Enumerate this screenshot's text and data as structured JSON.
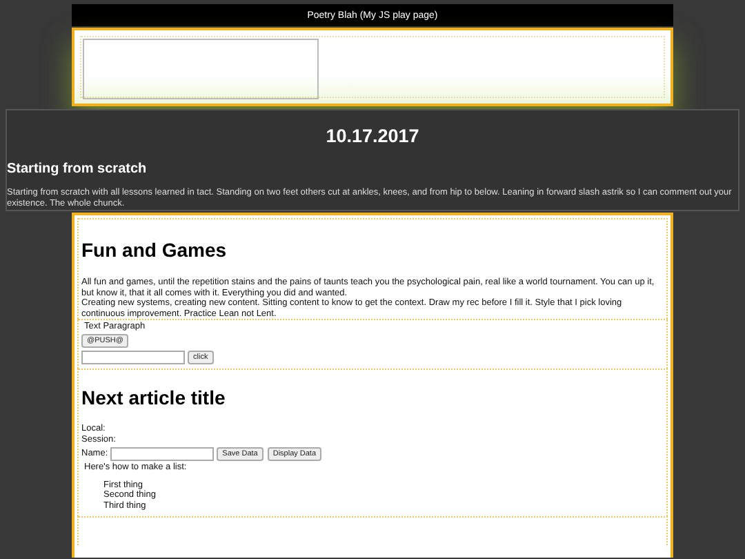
{
  "header": {
    "title": "Poetry Blah (My JS play page)"
  },
  "banner": {
    "date": "10.17.2017",
    "heading": "Starting from scratch",
    "text": "Starting from scratch with all lessons learned in tact. Standing on two feet others cut at ankles, knees, and from hip to below. Leaning in forward slash astrik so I can comment out your existence. The whole chunck."
  },
  "article": {
    "title": "Fun and Games",
    "paragraph": "All fun and games, until the repetition stains and the pains of taunts teach you the psychological pain, real like a world tournament. You can up it, but know it, that it all comes with it. Everything you did and wanted.",
    "paragraph_2": "Creating new systems, creating new content. Sitting content to know to get the context. Draw my rec before I fill it. Style that I pick loving continuous improvement. Practice Lean not Lent."
  },
  "widget": {
    "label": "Text Paragraph",
    "push_button": "@PUSH@",
    "click_button": "click"
  },
  "article_2": {
    "title": "Next article title",
    "local_label": "Local:",
    "session_label": "Session:",
    "name_label": "Name:",
    "save_button": "Save Data",
    "display_button": "Display Data",
    "list_intro": "Here's how to make a list:",
    "list_items": [
      "First thing",
      "Second thing",
      "Third thing"
    ]
  }
}
